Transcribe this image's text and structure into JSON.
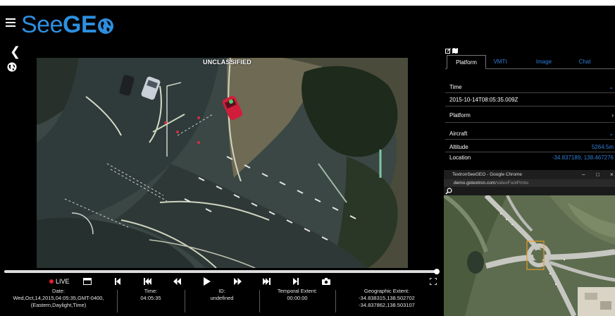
{
  "header": {
    "logo_part1": "See",
    "logo_part2": "GE",
    "menu_icon": "hamburger-icon",
    "back_icon": "chevron-left-icon",
    "globe_icon": "globe-icon",
    "brand_color": "#2e8fe0"
  },
  "video": {
    "classification": "UNCLASSIFIED",
    "progress": 1.0
  },
  "controls": {
    "live_label": "LIVE",
    "live_color": "#e3202a",
    "icons": [
      "window-icon",
      "skip-start-icon",
      "skip-back-icon",
      "rewind-icon",
      "play-icon",
      "fast-forward-icon",
      "skip-forward-icon",
      "skip-end-icon",
      "camera-icon",
      "fullscreen-icon"
    ]
  },
  "metadata": {
    "date_label": "Date:",
    "date_value_1": "Wed,Oct,14,2015,04:05:35,GMT-0400,",
    "date_value_2": "(Eastern,Daylight,Time)",
    "time_label": "Time:",
    "time_value": "04:05:35",
    "id_label": "ID:",
    "id_value": "undefined",
    "temporal_label": "Temporal Extent:",
    "temporal_value": "00:00:00",
    "geo_label": "Geographic Extent:",
    "geo_value_1": "-34.838315,138.502702",
    "geo_value_2": "-34.837862,138.503107"
  },
  "panel": {
    "tabs": [
      "Platform",
      "VMTI",
      "Image",
      "Chat"
    ],
    "active_tab": "Platform",
    "time_label": "Time",
    "time_value": "2015-10-14T08:05:35.009Z",
    "platform_label": "Platform",
    "aircraft_label": "Aircraft",
    "altitude_label": "Altitude",
    "altitude_value": "5264.5m",
    "location_label": "Location",
    "location_value": "-34.837189, 138.467276"
  },
  "browser": {
    "title": "TextronSeeGEO - Google Chrome",
    "url_host": "demo.gotextron.com",
    "url_path": "/videoFootPrints",
    "min_icon": "minimize-icon",
    "max_icon": "maximize-icon",
    "close_icon": "close-icon"
  }
}
